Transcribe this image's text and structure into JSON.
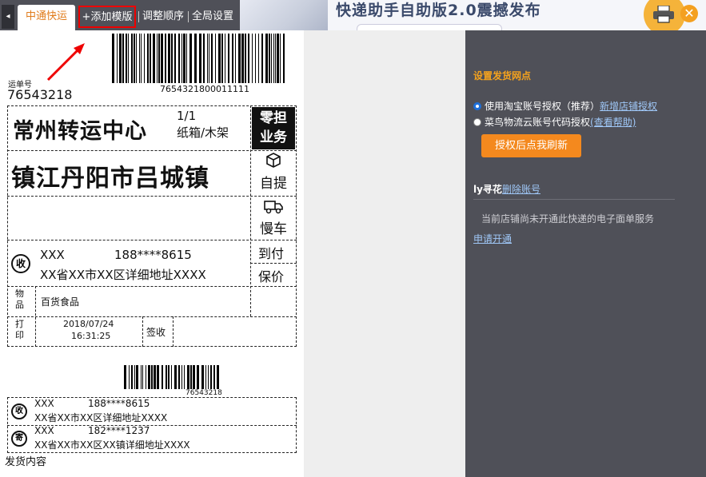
{
  "toolbar": {
    "active_tab": "中通快运",
    "add_template": "添加模版",
    "add_icon": "+",
    "adjust_order": "调整顺序",
    "global_settings": "全局设置",
    "collapse_icon": "◂"
  },
  "banner": {
    "title": "快递助手自助版2.0震撼发布",
    "close_icon": "✕"
  },
  "label": {
    "waybill_label": "运单号",
    "waybill_no": "76543218",
    "barcode_number": "7654321800011111",
    "transfer_center": "常州转运中心",
    "piece": "1/1",
    "package": "纸箱/木架",
    "tag_lingdan": "零担",
    "tag_yewu": "业务",
    "destination": "镇江丹阳市吕城镇",
    "self_pickup": "自提",
    "slow_car": "慢车",
    "pay_on_arrival": "到付",
    "insured": "保价",
    "receiver_icon": "收",
    "receiver_name": "XXX",
    "receiver_phone": "188****8615",
    "receiver_address": "XX省XX市XX区详细地址XXXX",
    "goods_label": "物品",
    "goods_label_1": "物",
    "goods_label_2": "品",
    "goods_value": "百货食品",
    "print_label_1": "打",
    "print_label_2": "印",
    "print_date": "2018/07/24",
    "print_time": "16:31:25",
    "sign_label": "签收",
    "barcode2_number": "76543218",
    "recv_name2": "XXX",
    "recv_phone2": "188****8615",
    "recv_address2": "XX省XX市XX区详细地址XXXX",
    "sender_icon": "寄",
    "sender_name": "XXX",
    "sender_phone": "182****1237",
    "sender_address": "XX省XX市XX区XX镇详细地址XXXX",
    "shipment_content": "发货内容"
  },
  "panel": {
    "title": "设置发货网点",
    "option_taobao": "使用淘宝账号授权（推荐）",
    "add_shop_auth": "新增店铺授权",
    "option_cainiao": "菜鸟物流云账号代码授权",
    "view_help": "(查看帮助)",
    "refresh_button": "授权后点我刷新",
    "account_name": "ly寻花",
    "delete_account": "删除账号",
    "notice": "当前店铺尚未开通此快递的电子面单服务",
    "apply_link": "申请开通"
  },
  "colors": {
    "accent_orange": "#f4891e",
    "panel_bg": "#4f5058",
    "highlight_red": "#ee0000"
  }
}
